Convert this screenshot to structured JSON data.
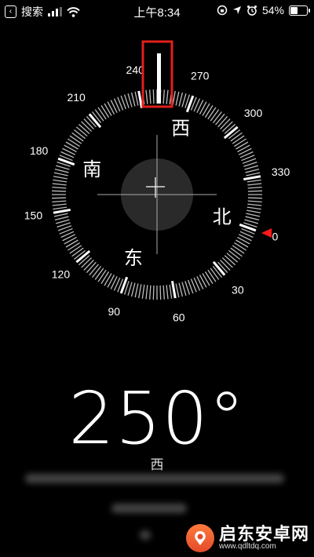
{
  "status_bar": {
    "back_label": "搜索",
    "time": "上午8:34",
    "battery": "54%",
    "battery_level": 0.54
  },
  "compass": {
    "heading_deg": 250,
    "degree_labels": [
      "0",
      "30",
      "60",
      "90",
      "120",
      "150",
      "180",
      "210",
      "240",
      "270",
      "300",
      "330"
    ],
    "cardinals": {
      "north": "北",
      "east": "东",
      "south": "南",
      "west": "西"
    },
    "accent_red": "#ff1a1a",
    "highlight_box_color": "#e0201c"
  },
  "heading": {
    "value": "250°",
    "direction": "西"
  },
  "watermark": {
    "name": "启东安卓网",
    "site": "www.qdltdq.com"
  }
}
